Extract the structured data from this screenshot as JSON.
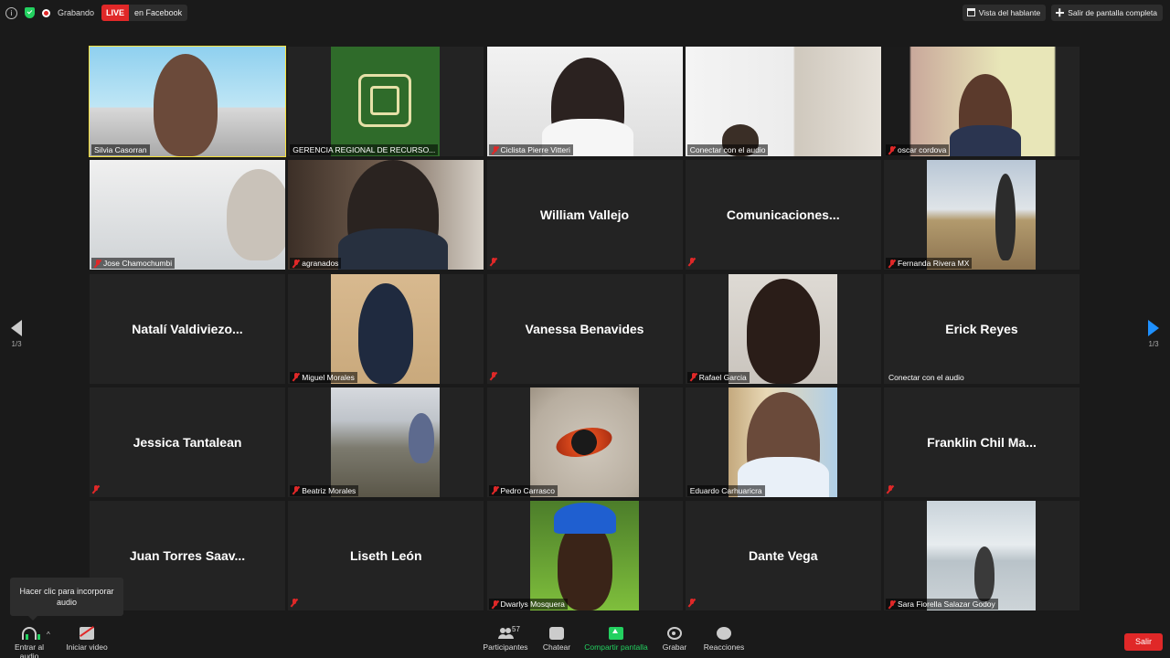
{
  "top_bar": {
    "recording_label": "Grabando",
    "live_badge": "LIVE",
    "live_destination": "en Facebook",
    "speaker_view": "Vista del hablante",
    "exit_fullscreen": "Salir de pantalla completa"
  },
  "pagination": {
    "left": "1/3",
    "right": "1/3"
  },
  "tiles": [
    {
      "name": "Silvia Casorran",
      "type": "video",
      "muted": false,
      "active": true
    },
    {
      "name": "GERENCIA REGIONAL DE RECURSO...",
      "type": "logo",
      "muted": false
    },
    {
      "name": "Ciclista Pierre Vitteri",
      "type": "video",
      "muted": true
    },
    {
      "name": "Conectar con el audio",
      "type": "video",
      "muted": false
    },
    {
      "name": "oscar cordova",
      "type": "video",
      "muted": true
    },
    {
      "name": "Jose Chamochumbi",
      "type": "video",
      "muted": true
    },
    {
      "name": "agranados",
      "type": "video",
      "muted": true
    },
    {
      "name": "William Vallejo",
      "type": "name",
      "muted": true
    },
    {
      "name": "Comunicaciones...",
      "type": "name",
      "muted": true
    },
    {
      "name": "Fernanda Rivera MX",
      "type": "photo",
      "muted": true
    },
    {
      "name": "Natalí  Valdiviezo...",
      "type": "name",
      "muted": false
    },
    {
      "name": "Miguel Morales",
      "type": "photo",
      "muted": true
    },
    {
      "name": "Vanessa Benavides",
      "type": "name",
      "muted": true
    },
    {
      "name": "Rafael Garcia",
      "type": "photo",
      "muted": true
    },
    {
      "name": "Erick Reyes",
      "type": "name",
      "muted": false,
      "sub": "Conectar con el audio"
    },
    {
      "name": "Jessica Tantalean",
      "type": "name",
      "muted": true
    },
    {
      "name": "Beatriz Morales",
      "type": "photo",
      "muted": true
    },
    {
      "name": "Pedro Carrasco",
      "type": "photo",
      "muted": true
    },
    {
      "name": "Eduardo Carhuaricra",
      "type": "photo",
      "muted": false
    },
    {
      "name": "Franklin  Chil  Ma...",
      "type": "name",
      "muted": true
    },
    {
      "name": "Juan  Torres  Saav...",
      "type": "name",
      "muted": false
    },
    {
      "name": "Liseth León",
      "type": "name",
      "muted": true
    },
    {
      "name": "Dwarlys Mosquera",
      "type": "photo",
      "muted": true
    },
    {
      "name": "Dante Vega",
      "type": "name",
      "muted": true
    },
    {
      "name": "Sara Fiorella Salazar Godoy",
      "type": "photo",
      "muted": true
    }
  ],
  "tooltip": {
    "text": "Hacer clic para incorporar audio"
  },
  "bottom_bar": {
    "join_audio": "Entrar al audio",
    "start_video": "Iniciar video",
    "participants": "Participantes",
    "participants_count": "57",
    "chat": "Chatear",
    "share_screen": "Compartir pantalla",
    "record": "Grabar",
    "reactions": "Reacciones",
    "exit": "Salir"
  }
}
